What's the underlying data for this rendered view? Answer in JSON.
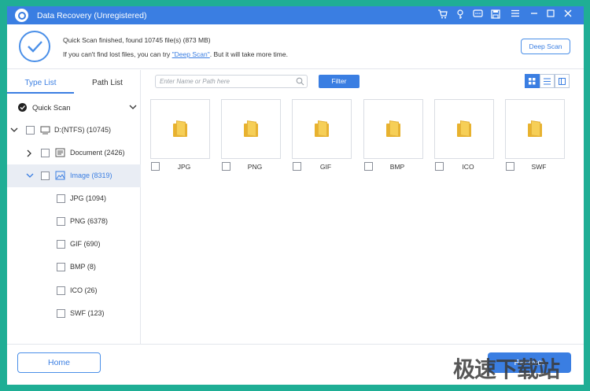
{
  "window": {
    "title": "Data Recovery (Unregistered)"
  },
  "titlebar_icons": [
    "cart-icon",
    "key-icon",
    "feedback-icon",
    "save-icon",
    "menu-icon",
    "minimize-icon",
    "maximize-icon",
    "close-icon"
  ],
  "header": {
    "scan_message": "Quick Scan finished, found 10745 file(s) (873 MB)",
    "hint_before": "If you can't find lost files, you can try ",
    "hint_link": "\"Deep Scan\"",
    "hint_after": ". But it will take more time.",
    "deep_scan_label": "Deep Scan"
  },
  "sidebar": {
    "tabs": [
      {
        "label": "Type List",
        "active": true
      },
      {
        "label": "Path List",
        "active": false
      }
    ],
    "scan_mode": "Quick Scan",
    "drive": "D:(NTFS) (10745)",
    "items": [
      {
        "label": "Document (2426)"
      },
      {
        "label": "Image (8319)",
        "selected": true
      }
    ],
    "image_children": [
      {
        "label": "JPG (1094)"
      },
      {
        "label": "PNG (6378)"
      },
      {
        "label": "GIF (690)"
      },
      {
        "label": "BMP (8)"
      },
      {
        "label": "ICO (26)"
      },
      {
        "label": "SWF (123)"
      }
    ]
  },
  "toolbar": {
    "search_placeholder": "Enter Name or Path here",
    "filter_label": "Filter",
    "active_view": "grid"
  },
  "grid": [
    {
      "label": "JPG"
    },
    {
      "label": "PNG"
    },
    {
      "label": "GIF"
    },
    {
      "label": "BMP"
    },
    {
      "label": "ICO"
    },
    {
      "label": "SWF"
    }
  ],
  "footer": {
    "home_label": "Home",
    "recover_label": "Recover"
  },
  "watermark": "极速下载站",
  "colors": {
    "accent": "#3a7ee2",
    "frame": "#1fae95"
  }
}
